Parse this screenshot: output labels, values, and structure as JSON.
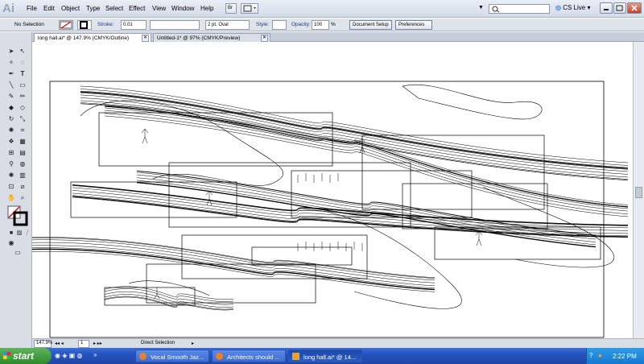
{
  "app": {
    "logo": "Ai"
  },
  "menu": [
    "File",
    "Edit",
    "Object",
    "Type",
    "Select",
    "Effect",
    "View",
    "Window",
    "Help"
  ],
  "toolbar_buttons": {
    "bridge": "Br"
  },
  "cs_live": "CS Live",
  "control_bar": {
    "selection": "No Selection",
    "stroke_label": "Stroke:",
    "stroke_weight": "0.01",
    "brush": "2 pt. Oval",
    "style_label": "Style:",
    "opacity_label": "Opacity:",
    "opacity_value": "100",
    "opacity_unit": "%",
    "document_setup": "Document Setup",
    "preferences": "Preferences"
  },
  "tabs": [
    {
      "label": "long hall.ai* @ 147.9% (CMYK/Outline)",
      "active": true
    },
    {
      "label": "Untitled-1* @ 97% (CMYK/Preview)",
      "active": false
    }
  ],
  "status_bar": {
    "zoom": "147.9%",
    "page": "1",
    "tool": "Direct Selection"
  },
  "taskbar": {
    "start": "start",
    "items": [
      "Vocal Smooth Jaz...",
      "Architects should ...",
      "long hall.ai* @ 14..."
    ],
    "clock": "2:22 PM"
  },
  "icons": [
    "selection-arrow-icon",
    "direct-selection-icon",
    "pen-icon",
    "type-icon",
    "line-icon",
    "rectangle-icon",
    "brush-icon",
    "pencil-icon",
    "rotate-icon",
    "scale-icon",
    "graph-icon",
    "zoom-icon",
    "hand-icon",
    "fill-stroke-icon"
  ],
  "colors": {
    "taskbar": "#2453bd",
    "start": "#2f8a2c"
  }
}
